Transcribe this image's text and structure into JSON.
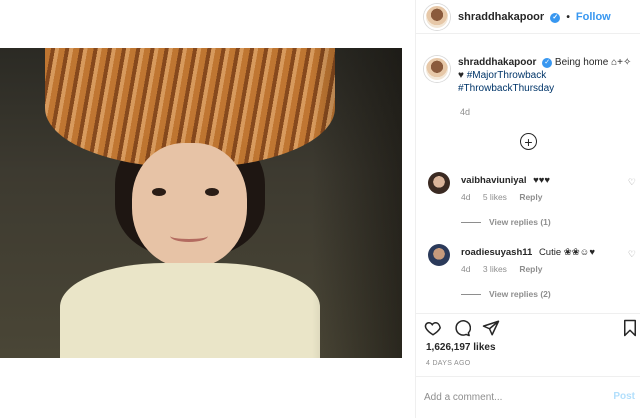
{
  "post": {
    "username": "shraddhakapoor",
    "follow_label": "Follow",
    "separator": "•",
    "caption_text": "Being home ⌂+✧",
    "caption_heart": "♥",
    "hashtags": [
      "#MajorThrowback",
      "#ThrowbackThursday"
    ],
    "caption_time": "4d",
    "likes": "1,626,197 likes",
    "time_ago": "4 DAYS AGO"
  },
  "comments": [
    {
      "username": "vaibhaviuniyal",
      "text": "♥♥♥",
      "time": "4d",
      "likes": "5 likes",
      "reply_label": "Reply",
      "view_replies": "View replies (1)"
    },
    {
      "username": "roadiesuyash11",
      "text": "Cutie ❀❀☺♥",
      "time": "4d",
      "likes": "3 likes",
      "reply_label": "Reply",
      "view_replies": "View replies (2)"
    }
  ],
  "add_comment": {
    "placeholder": "Add a comment...",
    "post_label": "Post"
  },
  "icons": {
    "load_more": "plus-circle-icon",
    "like": "heart-icon",
    "comment": "comment-icon",
    "share": "share-icon",
    "save": "bookmark-icon"
  },
  "colors": {
    "accent": "#3897f0",
    "hashtag": "#003569",
    "muted": "#8e8e8e",
    "post_disabled": "#b2dffc"
  }
}
